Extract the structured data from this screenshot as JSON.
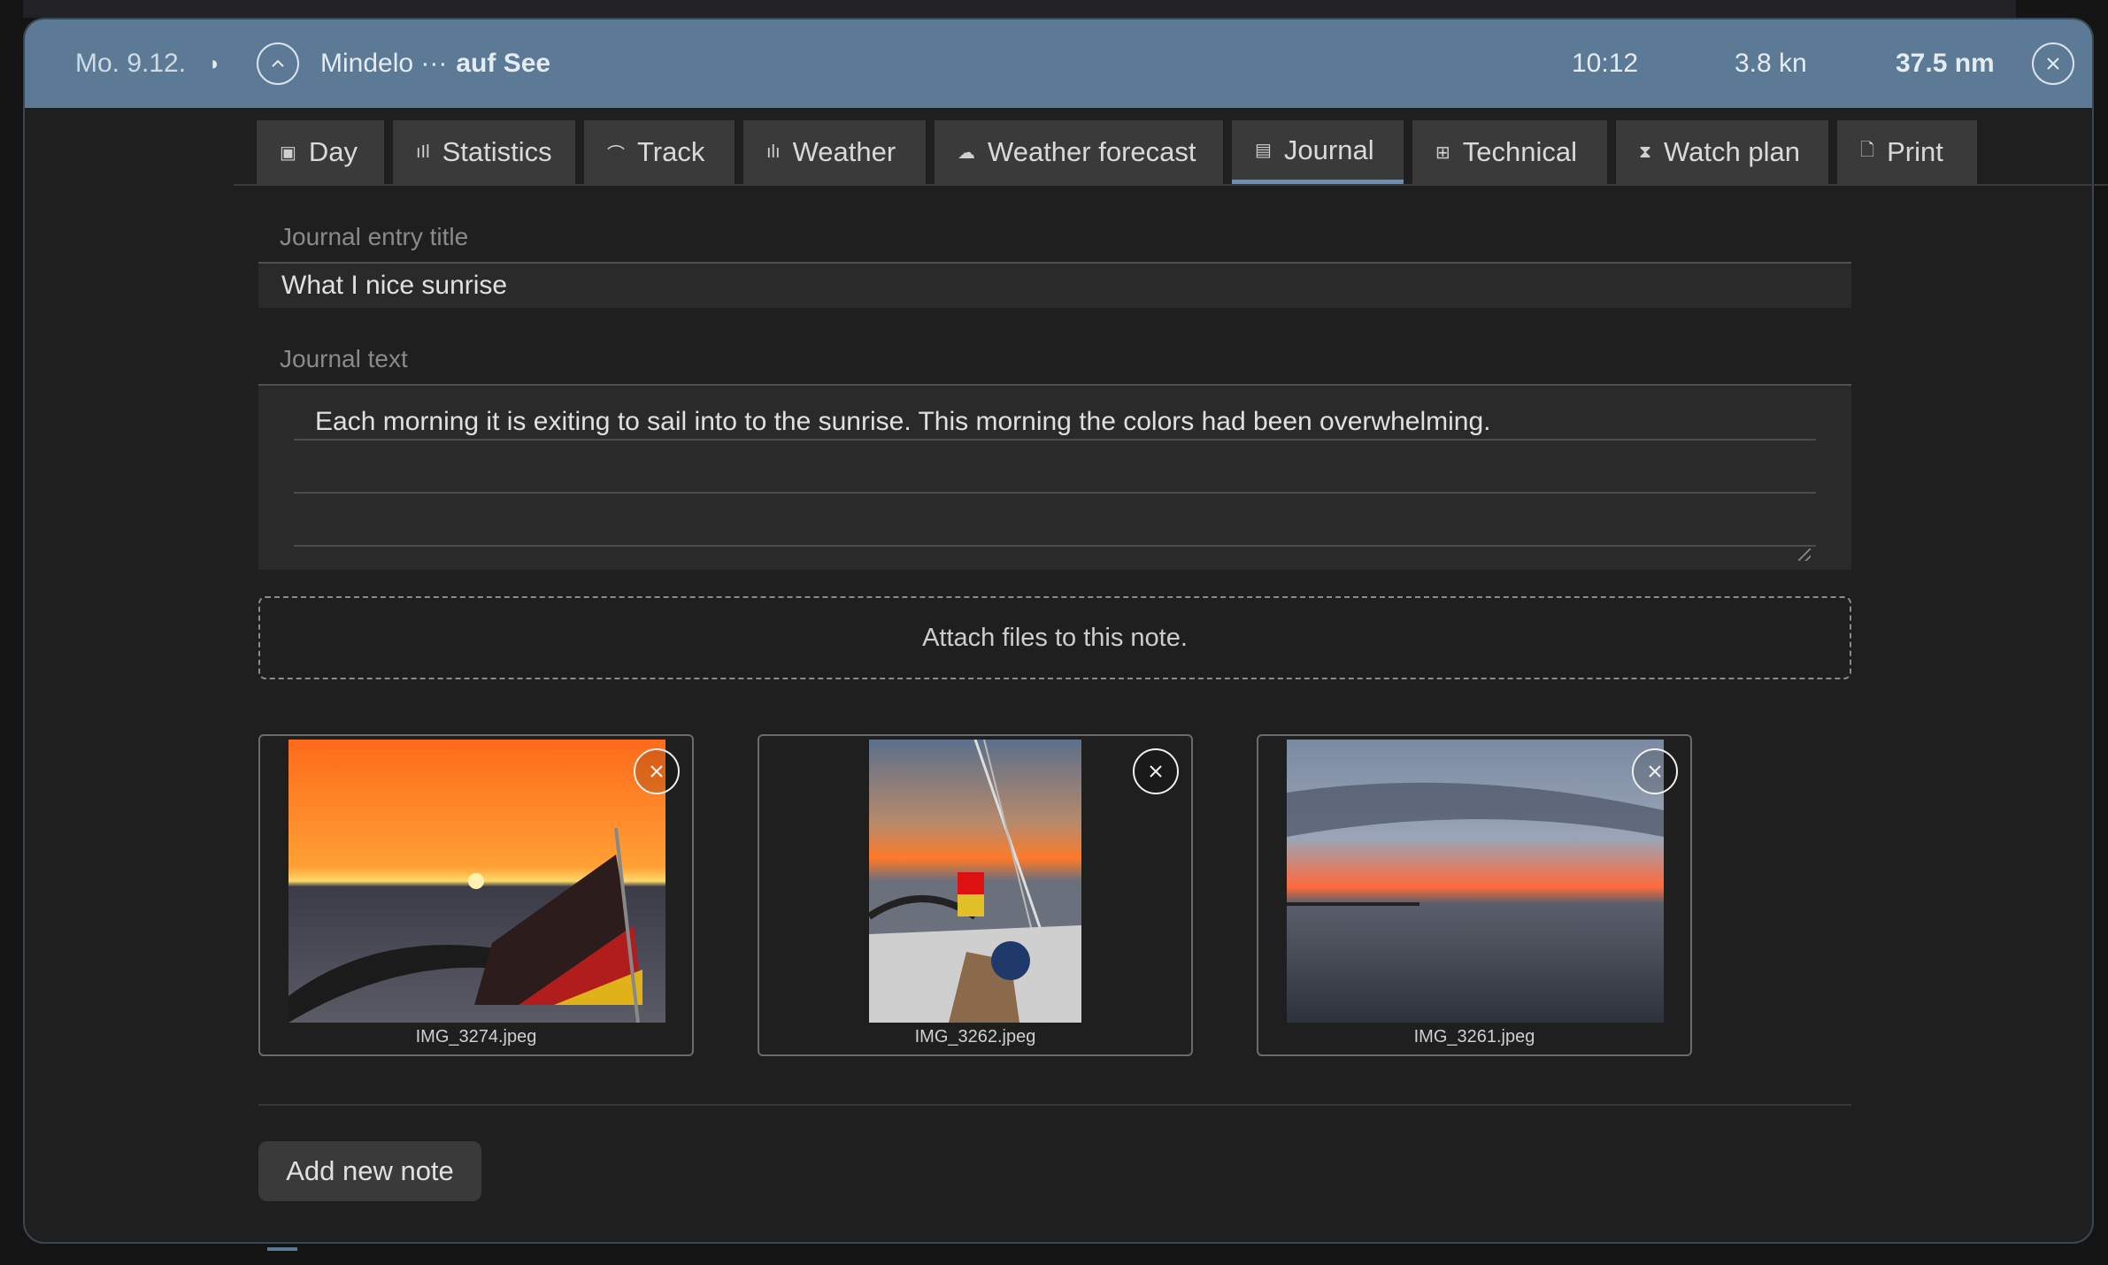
{
  "header": {
    "date": "Mo. 9.12.",
    "play_icon": "◗",
    "route_from": "Mindelo ···",
    "route_status": "auf See",
    "time": "10:12",
    "speed": "3.8 kn",
    "distance": "37.5 nm",
    "background": "#5c7a96"
  },
  "tabs": [
    {
      "label": "Day",
      "icon": "calendar-icon"
    },
    {
      "label": "Statistics",
      "icon": "bar-chart-icon"
    },
    {
      "label": "Track",
      "icon": "track-icon"
    },
    {
      "label": "Weather",
      "icon": "weather-chart-icon"
    },
    {
      "label": "Weather forecast",
      "icon": "cloud-sun-icon"
    },
    {
      "label": "Journal",
      "icon": "journal-icon",
      "active": true
    },
    {
      "label": "Technical",
      "icon": "technical-icon"
    },
    {
      "label": "Watch plan",
      "icon": "hourglass-icon"
    },
    {
      "label": "Print",
      "icon": "document-icon"
    }
  ],
  "journal": {
    "title_label": "Journal entry title",
    "title_value": "What I nice sunrise",
    "text_label": "Journal text",
    "text_value": "Each morning it is exiting to sail into to the sunrise. This morning the colors had been overwhelming.",
    "attach_label": "Attach files to this note."
  },
  "attachments": [
    {
      "filename": "IMG_3274.jpeg"
    },
    {
      "filename": "IMG_3262.jpeg"
    },
    {
      "filename": "IMG_3261.jpeg"
    }
  ],
  "actions": {
    "add_note": "Add new note"
  },
  "colors": {
    "accent": "#6b8fb2",
    "tab_bg": "#3a3a3a",
    "panel_bg": "#1f1f1f"
  }
}
